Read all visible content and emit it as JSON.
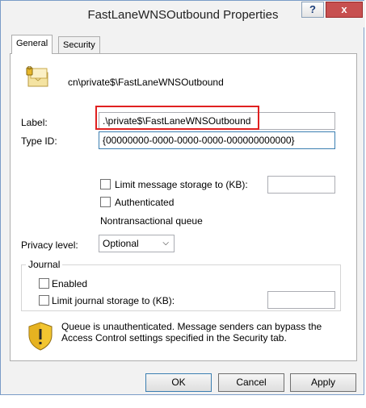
{
  "window": {
    "title": "FastLaneWNSOutbound Properties",
    "help_label": "?",
    "close_label": "x"
  },
  "tabs": [
    {
      "label": "General",
      "active": true
    },
    {
      "label": "Security",
      "active": false
    }
  ],
  "general": {
    "queue_path": "cn\\private$\\FastLaneWNSOutbound",
    "label_caption": "Label:",
    "label_value": ".\\private$\\FastLaneWNSOutbound",
    "typeid_caption": "Type ID:",
    "typeid_value": "{00000000-0000-0000-0000-000000000000}",
    "limit_storage_label": "Limit message storage to (KB):",
    "limit_storage_value": "",
    "authenticated_label": "Authenticated",
    "nontransactional_label": "Nontransactional queue",
    "privacy_caption": "Privacy level:",
    "privacy_value": "Optional",
    "journal_title": "Journal",
    "journal_enabled_label": "Enabled",
    "journal_limit_label": "Limit journal storage to (KB):",
    "journal_limit_value": "",
    "warning_text": "Queue is unauthenticated. Message senders can bypass the Access Control settings specified in the Security tab."
  },
  "buttons": {
    "ok": "OK",
    "cancel": "Cancel",
    "apply": "Apply"
  },
  "icons": {
    "queue": "queue-envelope-icon",
    "warning": "shield-warning-icon"
  },
  "colors": {
    "highlight": "#e02020",
    "close_button": "#c75050"
  }
}
